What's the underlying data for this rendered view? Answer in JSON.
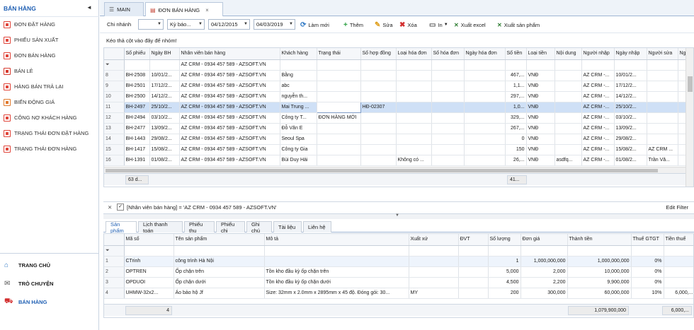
{
  "sidebar": {
    "title": "BÁN HÀNG",
    "collapse_glyph": "◄",
    "items": [
      {
        "label": "Đơn đặt hàng",
        "icon": "order-icon",
        "color": "#e0453a"
      },
      {
        "label": "Phiếu sản xuất",
        "icon": "production-icon",
        "color": "#e0453a"
      },
      {
        "label": "Đơn bán hàng",
        "icon": "sales-order-icon",
        "color": "#e0453a"
      },
      {
        "label": "Bán lẻ",
        "icon": "retail-icon",
        "color": "#d6392e"
      },
      {
        "label": "Hàng bán trả lại",
        "icon": "return-icon",
        "color": "#e0453a"
      },
      {
        "label": "Biến động giá",
        "icon": "price-change-icon",
        "color": "#e07a2e"
      },
      {
        "label": "Công nợ khách hàng",
        "icon": "customer-debt-icon",
        "color": "#e0453a"
      },
      {
        "label": "Trạng thái đơn đặt hàng",
        "icon": "order-status-icon",
        "color": "#e0453a"
      },
      {
        "label": "Trạng thái đơn hàng",
        "icon": "sales-status-icon",
        "color": "#e0453a"
      }
    ],
    "bottom": [
      {
        "label": "Trang chủ",
        "icon": "home-icon"
      },
      {
        "label": "Trò chuyện",
        "icon": "chat-icon"
      },
      {
        "label": "Bán hàng",
        "icon": "cart-icon"
      }
    ]
  },
  "tabs": [
    {
      "label": "MAIN",
      "icon": "list-icon"
    },
    {
      "label": "ĐƠN BÁN HÀNG",
      "icon": "document-icon",
      "close": "×"
    }
  ],
  "toolbar": {
    "branch_label": "Chi nhánh",
    "period_value": "Kỳ báo...",
    "date_from": "04/12/2015",
    "date_to": "04/03/2019",
    "refresh_label": "Làm mới",
    "add_label": "Thêm",
    "edit_label": "Sửa",
    "delete_label": "Xóa",
    "print_label": "In",
    "export_excel_label": "Xuất excel",
    "export_product_label": "Xuất sản phẩm"
  },
  "group_panel_text": "Kéo thả cột vào đây để nhóm!",
  "main_grid": {
    "columns": [
      "Số phiếu",
      "Ngày BH",
      "Nhân viên bán hàng",
      "Khách hàng",
      "Trạng thái",
      "Số hợp đồng",
      "Loại hóa đơn",
      "Số hóa đơn",
      "Ngày hóa đơn",
      "Số tiền",
      "Loại tiền",
      "Nội dung",
      "Người nhập",
      "Ngày nhập",
      "Người sửa",
      "Ngày"
    ],
    "filter_value": "AZ CRM - 0934 457 589 - AZSOFT.VN",
    "rows": [
      {
        "n": "8",
        "cells": [
          "BH-2508",
          "10/01/2...",
          "AZ CRM - 0934 457 589 - AZSOFT.VN",
          "Bằng",
          "",
          "",
          "",
          "",
          "",
          "467,...",
          "VNĐ",
          "",
          "AZ CRM -...",
          "10/01/2...",
          "",
          ""
        ]
      },
      {
        "n": "9",
        "cells": [
          "BH-2501",
          "17/12/2...",
          "AZ CRM - 0934 457 589 - AZSOFT.VN",
          "abc",
          "",
          "",
          "",
          "",
          "",
          "1,1...",
          "VNĐ",
          "",
          "AZ CRM -...",
          "17/12/2...",
          "",
          ""
        ]
      },
      {
        "n": "10",
        "cells": [
          "BH-2500",
          "14/12/2...",
          "AZ CRM - 0934 457 589 - AZSOFT.VN",
          "nguyễn th...",
          "",
          "",
          "",
          "",
          "",
          "297,...",
          "VNĐ",
          "",
          "AZ CRM -...",
          "14/12/2...",
          "",
          ""
        ]
      },
      {
        "n": "11",
        "cells": [
          "BH-2497",
          "25/10/2...",
          "AZ CRM - 0934 457 589 - AZSOFT.VN",
          "Mai Trung ...",
          "",
          "HĐ-02307",
          "",
          "",
          "",
          "1,0...",
          "VNĐ",
          "",
          "AZ CRM -...",
          "25/10/2...",
          "",
          ""
        ],
        "selected": true
      },
      {
        "n": "12",
        "cells": [
          "BH-2494",
          "03/10/2...",
          "AZ CRM - 0934 457 589 - AZSOFT.VN",
          "Công ty T...",
          "ĐƠN HÀNG MỚI",
          "",
          "",
          "",
          "",
          "329,...",
          "VNĐ",
          "",
          "AZ CRM -...",
          "03/10/2...",
          "",
          ""
        ]
      },
      {
        "n": "13",
        "cells": [
          "BH-2477",
          "13/09/2...",
          "AZ CRM - 0934 457 589 - AZSOFT.VN",
          "Đỗ Văn E",
          "",
          "",
          "",
          "",
          "",
          "267,...",
          "VNĐ",
          "",
          "AZ CRM -...",
          "13/09/2...",
          "",
          ""
        ]
      },
      {
        "n": "14",
        "cells": [
          "BH-1443",
          "29/08/2...",
          "AZ CRM - 0934 457 589 - AZSOFT.VN",
          "Seoul Spa",
          "",
          "",
          "",
          "",
          "",
          "0",
          "VNĐ",
          "",
          "AZ CRM -...",
          "29/08/2...",
          "",
          ""
        ]
      },
      {
        "n": "15",
        "cells": [
          "BH-1417",
          "15/08/2...",
          "AZ CRM - 0934 457 589 - AZSOFT.VN",
          "Công ty Gia",
          "",
          "",
          "",
          "",
          "",
          "150",
          "VNĐ",
          "",
          "AZ CRM -...",
          "15/08/2...",
          "AZ CRM ...",
          ""
        ]
      },
      {
        "n": "16",
        "cells": [
          "BH-1391",
          "01/08/2...",
          "AZ CRM - 0934 457 589 - AZSOFT.VN",
          "Bùi Duy Hải",
          "",
          "",
          "Không có ...",
          "",
          "",
          "26,...",
          "VNĐ",
          "asdfq...",
          "AZ CRM -...",
          "01/08/2...",
          "Trần Vă...",
          ""
        ]
      }
    ],
    "count_summary": "63 d...",
    "amount_summary": "41..."
  },
  "filter_bar": {
    "expression": "[Nhân viên bán hàng] = 'AZ CRM - 0934 457 589 - AZSOFT.VN'",
    "edit_label": "Edit Filter"
  },
  "detail_tabs": [
    "Sản phẩm",
    "Lịch thanh toán",
    "Phiếu thu",
    "Phiếu chi",
    "Ghi chú",
    "Tài liệu",
    "Liên hệ"
  ],
  "detail_grid": {
    "columns": [
      "Mã số",
      "Tên sản phẩm",
      "Mô tả",
      "Xuất xứ",
      "ĐVT",
      "Số lượng",
      "Đơn giá",
      "Thành tiền",
      "Thuế GTGT",
      "Tiền thuế"
    ],
    "rows": [
      {
        "n": "1",
        "cells": [
          "CTrinh",
          "công trình Hà Nội",
          "",
          "",
          "",
          "1",
          "1,000,000,000",
          "1,000,000,000",
          "0%",
          ""
        ]
      },
      {
        "n": "2",
        "cells": [
          "OPTREN",
          "Ốp chặn trên",
          "Tồn kho đầu kỳ ốp chặn trên",
          "",
          "",
          "5,000",
          "2,000",
          "10,000,000",
          "0%",
          ""
        ]
      },
      {
        "n": "3",
        "cells": [
          "OPDUOI",
          "Ốp chặn dưới",
          "Tồn kho đầu kỳ ốp chặn dưới",
          "",
          "",
          "4,500",
          "2,200",
          "9,900,000",
          "0%",
          ""
        ]
      },
      {
        "n": "4",
        "cells": [
          "UHMW-32x2...",
          "Áo bảo hộ Jf",
          "Size: 32mm x 2.0mm x 2895mm x 45 độ. Đóng gói: 30...",
          "MY",
          "",
          "200",
          "300,000",
          "60,000,000",
          "10%",
          "6,000,..."
        ]
      }
    ],
    "count_summary": "4",
    "total_summary": "1,079,900,000",
    "tax_summary": "6,000,..."
  }
}
